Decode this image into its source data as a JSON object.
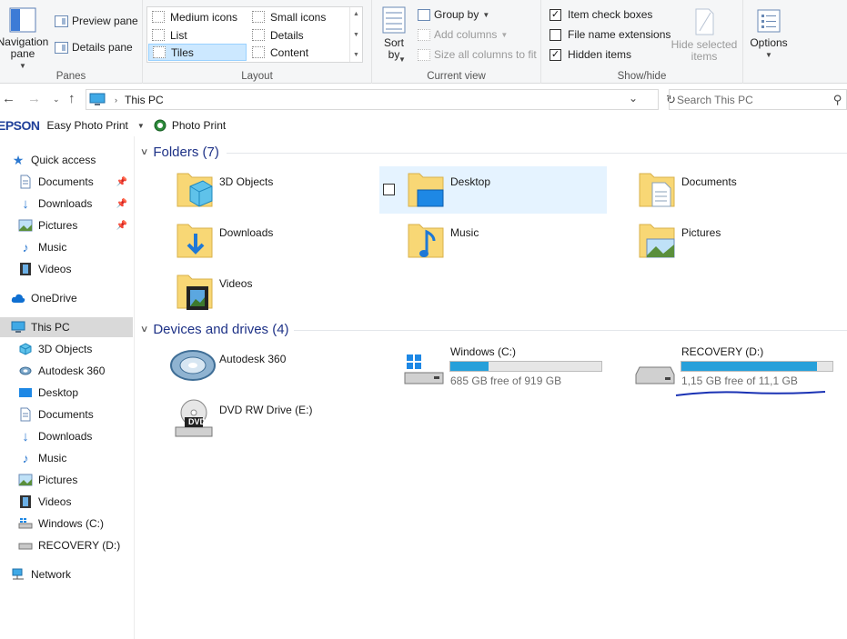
{
  "ribbon": {
    "panes": {
      "label": "Panes",
      "navigation_pane": "Navigation\npane",
      "preview_pane": "Preview pane",
      "details_pane": "Details pane"
    },
    "layout": {
      "label": "Layout",
      "options": [
        "Medium icons",
        "Small icons",
        "List",
        "Details",
        "Tiles",
        "Content"
      ],
      "selected": "Tiles"
    },
    "current_view": {
      "label": "Current view",
      "sort_by": "Sort\nby",
      "group_by": "Group by",
      "add_columns": "Add columns",
      "size_columns": "Size all columns to fit"
    },
    "show_hide": {
      "label": "Show/hide",
      "item_check_boxes": "Item check boxes",
      "file_name_extensions": "File name extensions",
      "hidden_items": "Hidden items",
      "item_check_boxes_checked": true,
      "file_name_extensions_checked": false,
      "hidden_items_checked": true,
      "hide_selected": "Hide selected\nitems"
    },
    "options": "Options"
  },
  "address": {
    "path": "This PC",
    "search_placeholder": "Search This PC"
  },
  "epson": {
    "logo": "EPSON",
    "easy_photo_print": "Easy Photo Print",
    "photo_print": "Photo Print"
  },
  "sidebar": {
    "quick_access": "Quick access",
    "quick_items": [
      "Documents",
      "Downloads",
      "Pictures",
      "Music",
      "Videos"
    ],
    "onedrive": "OneDrive",
    "this_pc": "This PC",
    "pc_items": [
      "3D Objects",
      "Autodesk 360",
      "Desktop",
      "Documents",
      "Downloads",
      "Music",
      "Pictures",
      "Videos",
      "Windows (C:)",
      "RECOVERY (D:)"
    ],
    "network": "Network"
  },
  "content": {
    "folders_header": "Folders (7)",
    "folders": [
      "3D Objects",
      "Desktop",
      "Documents",
      "Downloads",
      "Music",
      "Pictures",
      "Videos"
    ],
    "devices_header": "Devices and drives (4)",
    "autodesk": "Autodesk 360",
    "dvd": "DVD RW Drive (E:)",
    "dvd_badge": "DVD",
    "drive_c": {
      "name": "Windows (C:)",
      "free": "685 GB free of 919 GB",
      "used_fraction": 0.255
    },
    "drive_d": {
      "name": "RECOVERY (D:)",
      "free": "1,15 GB free of 11,1 GB",
      "used_fraction": 0.896
    }
  },
  "colors": {
    "accent": "#26a0da",
    "folder": "#f8d775",
    "section_header": "#1e3287",
    "annotation": "#1a32b4"
  }
}
